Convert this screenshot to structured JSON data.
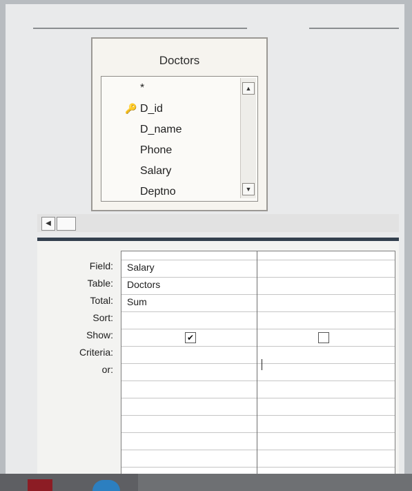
{
  "field_list": {
    "table_name": "Doctors",
    "fields": [
      "*",
      "D_id",
      "D_name",
      "Phone",
      "Salary",
      "Deptno"
    ],
    "primary_key_icon": "key-icon",
    "scroll_up_icon": "scroll-up-arrow-icon",
    "scroll_down_icon": "scroll-down-arrow-icon"
  },
  "hscroll": {
    "left_icon": "scroll-left-arrow-icon"
  },
  "grid": {
    "row_labels": [
      "Field:",
      "Table:",
      "Total:",
      "Sort:",
      "Show:",
      "Criteria:",
      "or:"
    ],
    "columns": [
      {
        "field": "Salary",
        "table": "Doctors",
        "total": "Sum",
        "sort": "",
        "show": true,
        "criteria": "",
        "or": ""
      },
      {
        "field": "",
        "table": "",
        "total": "",
        "sort": "",
        "show": false,
        "criteria": "",
        "or": ""
      }
    ]
  },
  "colors": {
    "divider": "#33404e",
    "field_box_bg": "#f6f4ef",
    "taskbar": "#5e5f63"
  }
}
